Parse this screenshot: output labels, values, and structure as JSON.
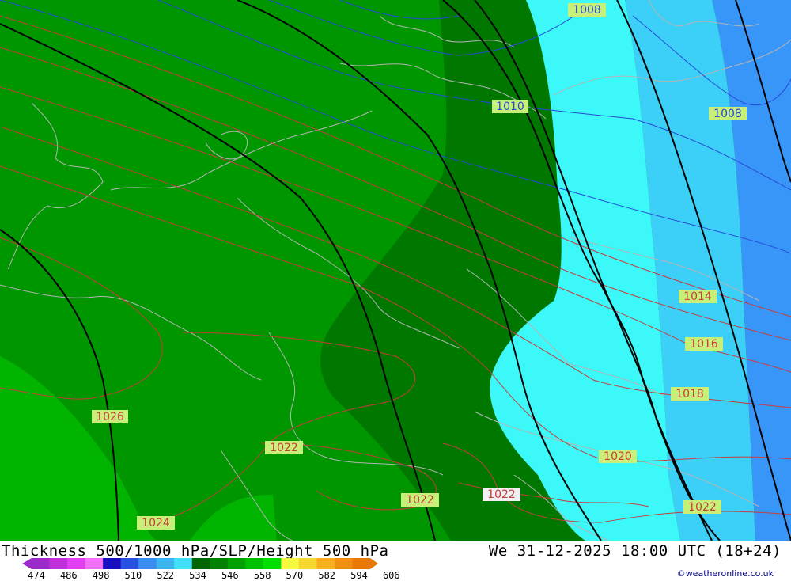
{
  "header": {
    "title": "Thickness 500/1000 hPa/SLP/Height 500 hPa",
    "datetime": "We 31-12-2025 18:00 UTC (18+24)",
    "credit": "©weatheronline.co.uk"
  },
  "colorbar": {
    "ticks": [
      "474",
      "486",
      "498",
      "510",
      "522",
      "534",
      "546",
      "558",
      "570",
      "582",
      "594",
      "606"
    ],
    "colors": [
      "#9b2ac8",
      "#c030d8",
      "#e040f0",
      "#f070f8",
      "#1810c0",
      "#2850e0",
      "#3c8cf0",
      "#3cb4f0",
      "#40e0f8",
      "#006400",
      "#008200",
      "#00a000",
      "#00c000",
      "#00e000",
      "#f8f840",
      "#f8d830",
      "#f8b020",
      "#f09010",
      "#e87808"
    ]
  },
  "map": {
    "isobar_labels": [
      "1008",
      "1008",
      "1010",
      "1014",
      "1016",
      "1018",
      "1020",
      "1022",
      "1022",
      "1022",
      "1022",
      "1024",
      "1026"
    ],
    "colors": {
      "green_light": "#00b400",
      "green_mid": "#009600",
      "green_dark": "#007800",
      "green_darker": "#006400",
      "cyan": "#3cf8f8",
      "sky": "#3cd0f8",
      "blue_mid": "#38b8f8",
      "blue_deep": "#3896f8",
      "isobar_red": "#c83c3c",
      "isobar_blue": "#2848d8",
      "height_line": "#000000",
      "border": "#b4b4b4"
    }
  }
}
